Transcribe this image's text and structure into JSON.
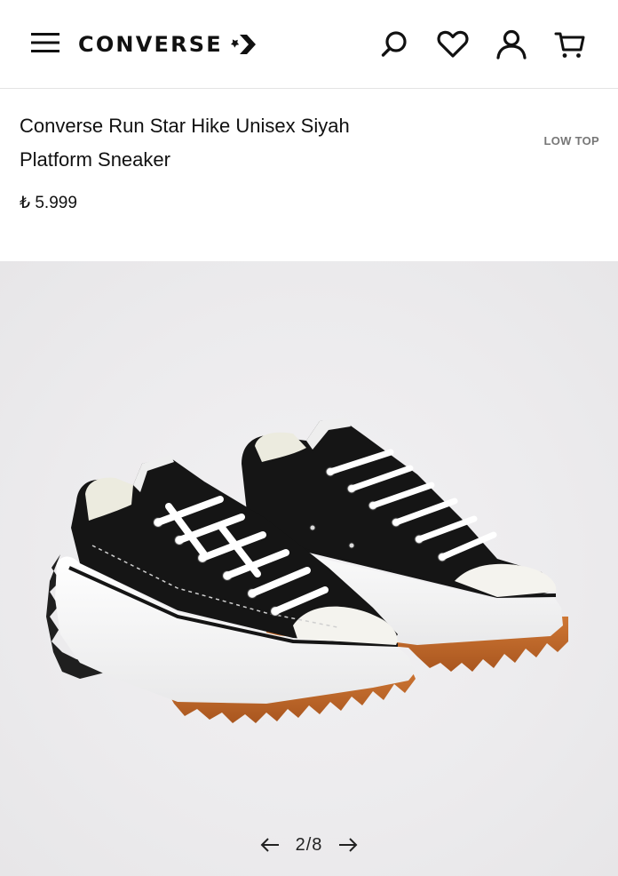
{
  "header": {
    "brand": "CONVERSE",
    "icons": [
      "menu-icon",
      "search-icon",
      "heart-icon",
      "user-icon",
      "cart-icon"
    ]
  },
  "product": {
    "title": "Converse Run Star Hike Unisex Siyah Platform Sneaker",
    "category": "LOW TOP",
    "price": "₺ 5.999"
  },
  "gallery": {
    "position": "2/8",
    "current_index": 2,
    "total_images": 8
  },
  "colors": {
    "upper": "#151515",
    "sole": "#ffffff",
    "gum": "#c26a2c",
    "background": "#ecebed"
  }
}
